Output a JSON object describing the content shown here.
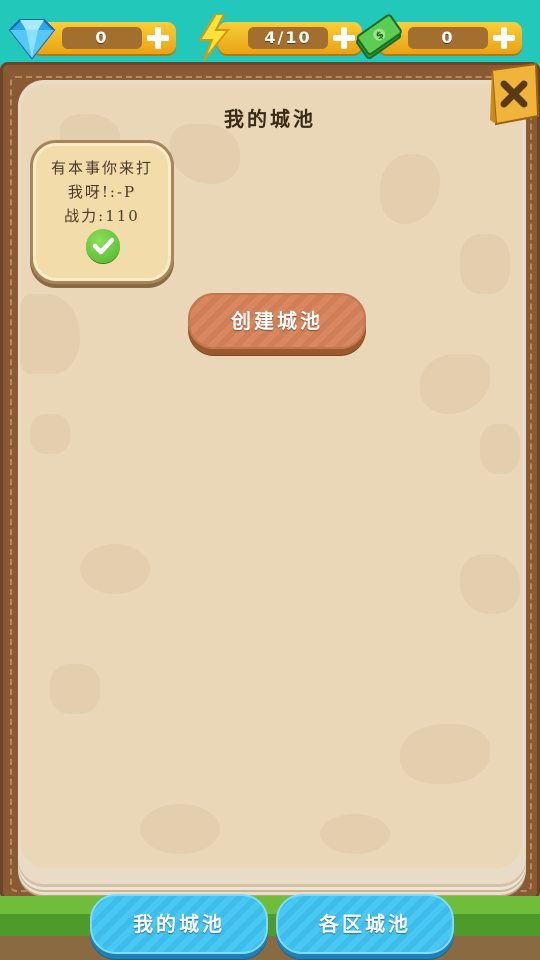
{
  "topbar": {
    "gems": {
      "icon": "diamond-icon",
      "value": "0"
    },
    "energy": {
      "icon": "lightning-icon",
      "value": "4/10"
    },
    "cash": {
      "icon": "cash-icon",
      "value": "0"
    }
  },
  "panel": {
    "title": "我的城池",
    "close_icon": "close-icon"
  },
  "city_card": {
    "line1": "有本事你来打",
    "line2": "我呀!:-P",
    "line3": "战力:110",
    "status_icon": "checkmark-icon"
  },
  "create_button": {
    "label": "创建城池"
  },
  "tabs": [
    {
      "label": "我的城池"
    },
    {
      "label": "各区城池"
    }
  ]
}
